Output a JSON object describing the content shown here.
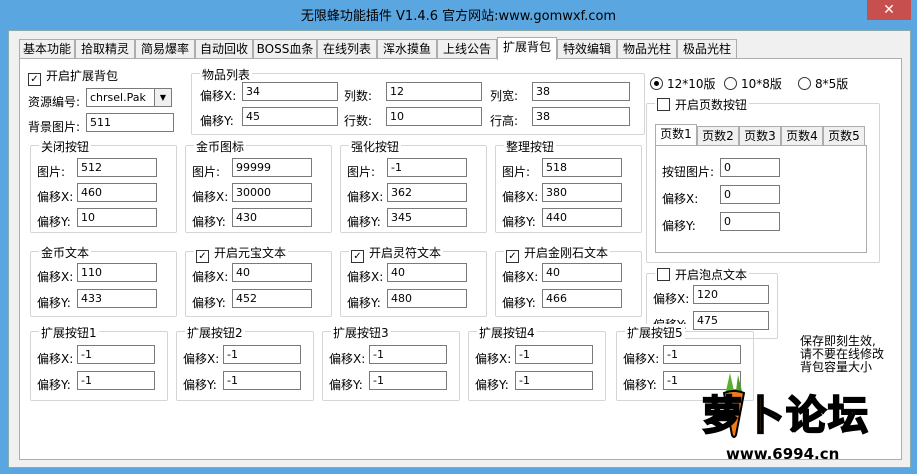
{
  "window": {
    "title": "无限蜂功能插件 V1.4.6 官方网站:www.gomwxf.com",
    "close": "✕"
  },
  "tabs": [
    "基本功能",
    "拾取精灵",
    "简易爆率",
    "自动回收",
    "BOSS血条",
    "在线列表",
    "浑水摸鱼",
    "上线公告",
    "扩展背包",
    "特效编辑",
    "物品光柱",
    "极品光柱"
  ],
  "active_tab": "扩展背包",
  "general": {
    "enable_label": "开启扩展背包",
    "enable_checked": true,
    "res_label": "资源编号:",
    "res_value": "chrsel.Pak",
    "bg_label": "背景图片:",
    "bg_value": "511"
  },
  "item_list": {
    "title": "物品列表",
    "offx_label": "偏移X:",
    "offx": "34",
    "offy_label": "偏移Y:",
    "offy": "45",
    "cols_label": "列数:",
    "cols": "12",
    "rows_label": "行数:",
    "rows": "10",
    "colw_label": "列宽:",
    "colw": "38",
    "rowh_label": "行高:",
    "rowh": "38"
  },
  "versions": {
    "opt1": "12*10版",
    "opt2": "10*8版",
    "opt3": "8*5版",
    "selected": 0
  },
  "paging": {
    "title": "开启页数按钮",
    "checked": false,
    "pages": [
      "页数1",
      "页数2",
      "页数3",
      "页数4",
      "页数5"
    ],
    "img_label": "按钮图片:",
    "img": "0",
    "offx_label": "偏移X:",
    "offx": "0",
    "offy_label": "偏移Y:",
    "offy": "0"
  },
  "close_btn": {
    "title": "关闭按钮",
    "img_label": "图片:",
    "img": "512",
    "offx_label": "偏移X:",
    "offx": "460",
    "offy_label": "偏移Y:",
    "offy": "10"
  },
  "gold_icon": {
    "title": "金币图标",
    "img_label": "图片:",
    "img": "99999",
    "offx_label": "偏移X:",
    "offx": "30000",
    "offy_label": "偏移Y:",
    "offy": "430"
  },
  "strengthen": {
    "title": "强化按钮",
    "img_label": "图片:",
    "img": "-1",
    "offx_label": "偏移X:",
    "offx": "362",
    "offy_label": "偏移Y:",
    "offy": "345"
  },
  "sort": {
    "title": "整理按钮",
    "img_label": "图片:",
    "img": "518",
    "offx_label": "偏移X:",
    "offx": "380",
    "offy_label": "偏移Y:",
    "offy": "440"
  },
  "gold_text": {
    "title": "金币文本",
    "offx_label": "偏移X:",
    "offx": "110",
    "offy_label": "偏移Y:",
    "offy": "433"
  },
  "yuanbao": {
    "title": "开启元宝文本",
    "checked": true,
    "offx_label": "偏移X:",
    "offx": "40",
    "offy_label": "偏移Y:",
    "offy": "452"
  },
  "lingfu": {
    "title": "开启灵符文本",
    "checked": true,
    "offx_label": "偏移X:",
    "offx": "40",
    "offy_label": "偏移Y:",
    "offy": "480"
  },
  "jingang": {
    "title": "开启金刚石文本",
    "checked": true,
    "offx_label": "偏移X:",
    "offx": "40",
    "offy_label": "偏移Y:",
    "offy": "466"
  },
  "paodian": {
    "title": "开启泡点文本",
    "checked": false,
    "offx_label": "偏移X:",
    "offx": "120",
    "offy_label": "偏移Y:",
    "offy": "475"
  },
  "ext_buttons": [
    {
      "title": "扩展按钮1",
      "offx_label": "偏移X:",
      "offx": "-1",
      "offy_label": "偏移Y:",
      "offy": "-1"
    },
    {
      "title": "扩展按钮2",
      "offx_label": "偏移X:",
      "offx": "-1",
      "offy_label": "偏移Y:",
      "offy": "-1"
    },
    {
      "title": "扩展按钮3",
      "offx_label": "偏移X:",
      "offx": "-1",
      "offy_label": "偏移Y:",
      "offy": "-1"
    },
    {
      "title": "扩展按钮4",
      "offx_label": "偏移X:",
      "offx": "-1",
      "offy_label": "偏移Y:",
      "offy": "-1"
    },
    {
      "title": "扩展按钮5",
      "offx_label": "偏移X:",
      "offx": "-1",
      "offy_label": "偏移Y:",
      "offy": "-1"
    }
  ],
  "note": [
    "保存即刻生效,",
    "请不要在线修改",
    "背包容量大小"
  ],
  "watermark": {
    "logo": "萝卜论坛",
    "url": "www.6994.cn"
  }
}
